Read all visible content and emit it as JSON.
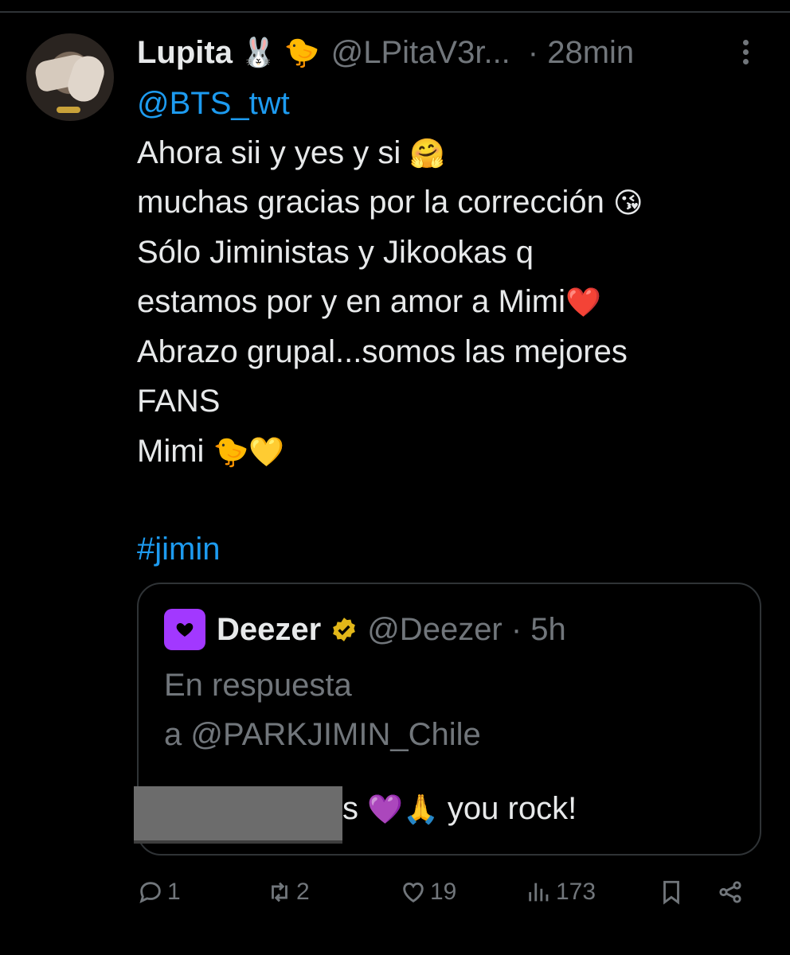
{
  "tweet": {
    "author_name": "Lupita",
    "author_emojis": [
      "🐰",
      "🐤"
    ],
    "handle": "@LPitaV3r...",
    "time": "· 28min",
    "mention": "@BTS_twt",
    "lines": [
      {
        "text": "Ahora sii y yes y si ",
        "emoji": "🤗"
      },
      {
        "text": "muchas gracias por la corrección ",
        "emoji": "😘"
      },
      {
        "text": "Sólo Jiministas y Jikookas q",
        "emoji": ""
      },
      {
        "text": "estamos por y en amor a Mimi",
        "emoji": "❤️"
      },
      {
        "text": "Abrazo grupal...somos las mejores",
        "emoji": ""
      },
      {
        "text": "FANS",
        "emoji": ""
      },
      {
        "text": "Mimi ",
        "emoji": "🐤💛"
      }
    ],
    "hashtag": "#jimin"
  },
  "quote": {
    "name": "Deezer",
    "handle": "@Deezer · 5h",
    "reply_prefix": "En respuesta",
    "reply_to": "a @PARKJIMIN_Chile",
    "partial_char": "s",
    "emojis": "💜🙏",
    "text": " you rock!"
  },
  "actions": {
    "replies": "1",
    "retweets": "2",
    "likes": "19",
    "views": "173"
  },
  "icons": {
    "more": "more-vertical-icon",
    "reply": "reply-icon",
    "retweet": "retweet-icon",
    "like": "heart-icon",
    "views": "views-icon",
    "bookmark": "bookmark-icon",
    "share": "share-icon",
    "verified": "verified-badge-icon",
    "deezer_logo": "deezer-logo-icon"
  },
  "colors": {
    "background": "#000000",
    "text": "#e7e9ea",
    "secondary": "#71767b",
    "link": "#1d9bf0",
    "deezer": "#a238ff",
    "verified": "#e2b719"
  }
}
